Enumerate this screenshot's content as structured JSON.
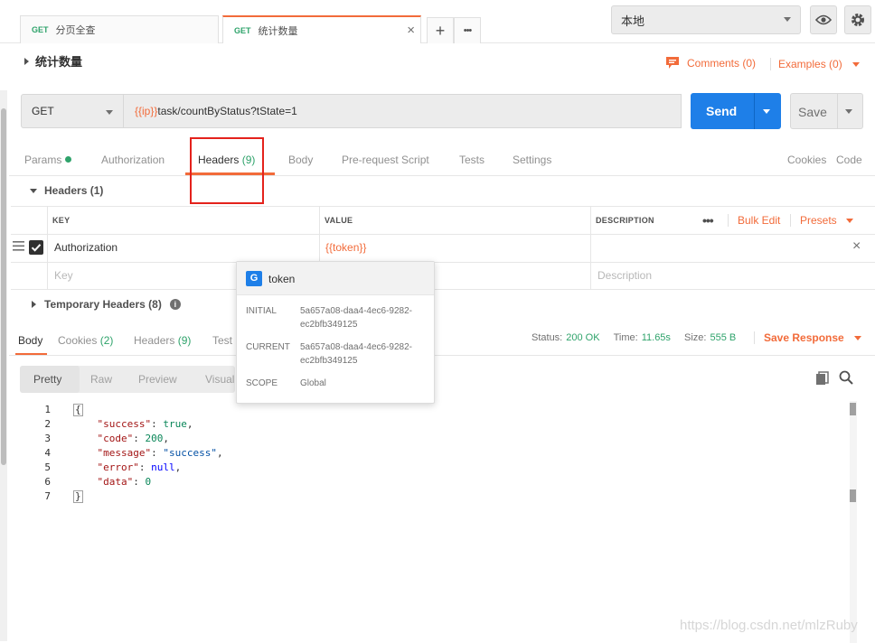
{
  "tabs": [
    {
      "method": "GET",
      "name": "分页全查"
    },
    {
      "method": "GET",
      "name": "统计数量",
      "close": "×"
    }
  ],
  "tab_actions": {
    "add": "+",
    "more": "•••"
  },
  "environment": {
    "selected": "本地"
  },
  "request": {
    "title": "统计数量",
    "comments": "Comments (0)",
    "examples": "Examples (0)",
    "method": "GET",
    "url_var": "{{ip}}",
    "url_path": "task/countByStatus?tState=1",
    "send_label": "Send",
    "save_label": "Save"
  },
  "request_tabs": {
    "params": "Params",
    "authorization": "Authorization",
    "headers": "Headers",
    "headers_count": "(9)",
    "body": "Body",
    "prerequest": "Pre-request Script",
    "tests": "Tests",
    "settings": "Settings",
    "cookies": "Cookies",
    "code": "Code"
  },
  "headers_section": {
    "title": "Headers (1)",
    "columns": {
      "key": "KEY",
      "value": "VALUE",
      "description": "DESCRIPTION"
    },
    "bulk_edit": "Bulk Edit",
    "presets": "Presets",
    "row": {
      "key": "Authorization",
      "value": "{{token}}",
      "close": "×"
    },
    "placeholders": {
      "key": "Key",
      "description": "Description"
    }
  },
  "temporary_headers": {
    "label": "Temporary Headers (8)",
    "info": "i"
  },
  "response_tabs": {
    "body": "Body",
    "cookies": "Cookies",
    "cookies_count": "(2)",
    "headers": "Headers",
    "headers_count": "(9)",
    "tests": "Test"
  },
  "response_status": {
    "status_label": "Status:",
    "status_value": "200 OK",
    "time_label": "Time:",
    "time_value": "11.65s",
    "size_label": "Size:",
    "size_value": "555 B",
    "save_response": "Save Response"
  },
  "view_tabs": {
    "pretty": "Pretty",
    "raw": "Raw",
    "preview": "Preview",
    "visualize": "Visual"
  },
  "code_lines": [
    {
      "n": "1",
      "text": "{"
    },
    {
      "n": "2",
      "key": "\"success\"",
      "val": "true",
      "kind": "n",
      "comma": ","
    },
    {
      "n": "3",
      "key": "\"code\"",
      "val": "200",
      "kind": "n",
      "comma": ","
    },
    {
      "n": "4",
      "key": "\"message\"",
      "val": "\"success\"",
      "kind": "s",
      "comma": ","
    },
    {
      "n": "5",
      "key": "\"error\"",
      "val": "null",
      "kind": "n",
      "comma": ","
    },
    {
      "n": "6",
      "key": "\"data\"",
      "val": "0",
      "kind": "n",
      "comma": ""
    },
    {
      "n": "7",
      "text": "}"
    }
  ],
  "tooltip": {
    "badge": "G",
    "name": "token",
    "initial_label": "INITIAL",
    "initial_value": "5a657a08-daa4-4ec6-9282-ec2bfb349125",
    "current_label": "CURRENT",
    "current_value": "5a657a08-daa4-4ec6-9282-ec2bfb349125",
    "scope_label": "SCOPE",
    "scope_value": "Global"
  },
  "watermark": "https://blog.csdn.net/mlzRuby",
  "colors": {
    "accent": "#f26b3a",
    "send": "#1e7fe8",
    "green": "#2fa36b",
    "highlight": "#e4221c"
  }
}
